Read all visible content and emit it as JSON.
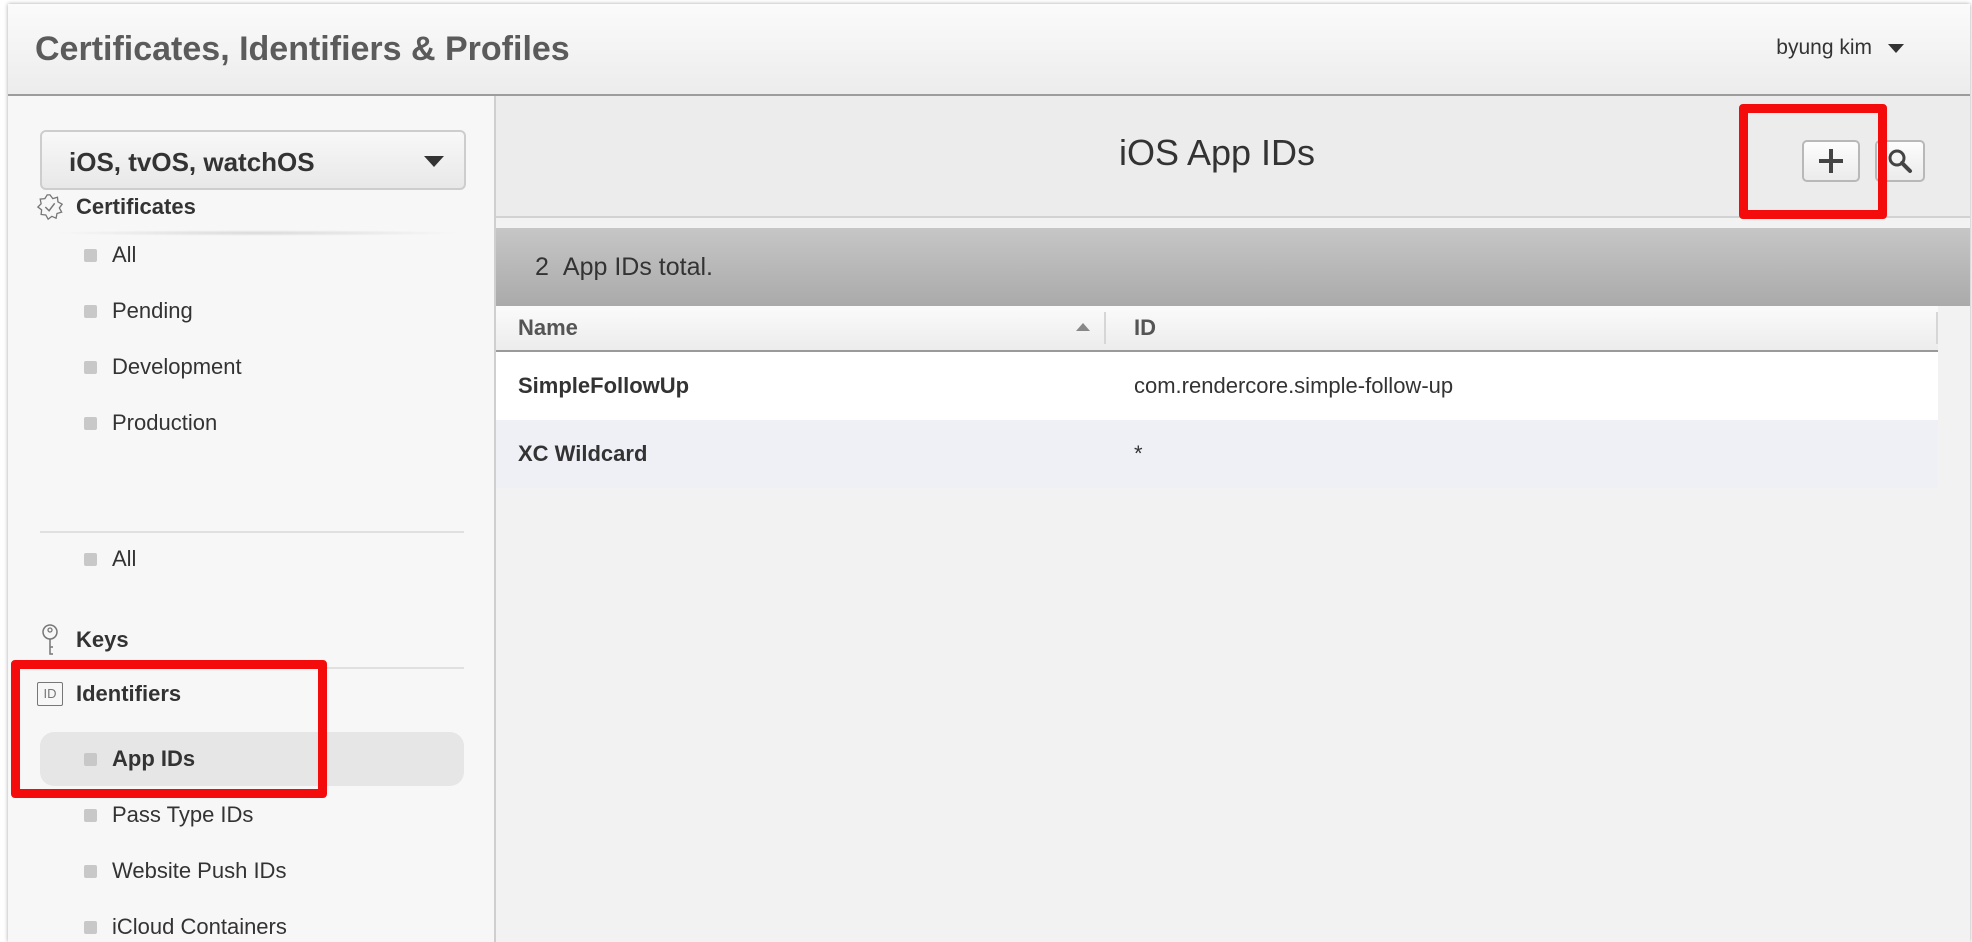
{
  "header": {
    "title": "Certificates, Identifiers & Profiles",
    "user_name": "byung kim"
  },
  "sidebar": {
    "platform": "iOS, tvOS, watchOS",
    "certificates": {
      "label": "Certificates",
      "items": [
        "All",
        "Pending",
        "Development",
        "Production"
      ]
    },
    "keys": {
      "label": "Keys",
      "items": [
        "All"
      ]
    },
    "identifiers": {
      "label": "Identifiers",
      "icon_text": "ID",
      "items": [
        "App IDs",
        "Pass Type IDs",
        "Website Push IDs",
        "iCloud Containers"
      ],
      "selected": "App IDs"
    }
  },
  "main": {
    "title": "iOS App IDs",
    "summary": {
      "count": "2",
      "text": "App IDs total."
    },
    "table": {
      "columns": [
        "Name",
        "ID"
      ],
      "sort": "Name ascending",
      "rows": [
        {
          "name": "SimpleFollowUp",
          "id": "com.rendercore.simple-follow-up"
        },
        {
          "name": "XC Wildcard",
          "id": "*"
        }
      ]
    }
  },
  "colors": {
    "highlight": "#f40b0b",
    "summary_bar": "#b4b4b4",
    "selected_item": "#e6e6e6"
  },
  "icons": [
    "certificate-icon",
    "key-icon",
    "id-icon",
    "plus-icon",
    "search-icon",
    "chevron-down-icon",
    "sort-ascending-icon"
  ]
}
